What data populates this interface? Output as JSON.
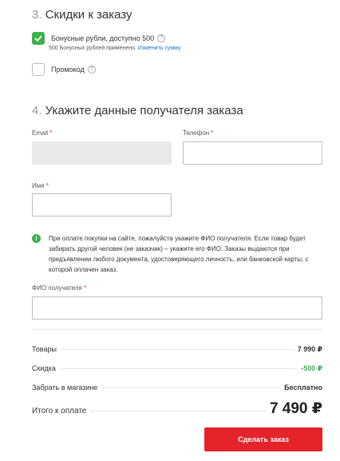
{
  "discounts": {
    "section_number": "3.",
    "section_title": "Скидки к заказу",
    "bonus_label": "Бонусные рубли, доступно 500",
    "bonus_checked": true,
    "bonus_applied_note": "500 Бонусных рублей применено.",
    "change_amount_link": "Изменить сумму",
    "promo_label": "Промокод",
    "promo_checked": false,
    "help_glyph": "?"
  },
  "recipient": {
    "section_number": "4.",
    "section_title": "Укажите данные получателя заказа",
    "email_label": "Email",
    "email_value": "",
    "phone_label": "Телефон",
    "phone_value": "",
    "name_label": "Имя",
    "name_value": "",
    "required_mark": "*",
    "info_text": "При оплате покупки на сайте, пожалуйста укажите ФИО получателя. Если товар будет забирать другой человек (не заказчик) – укажите его ФИО. Заказы выдаются при предъявлении любого документа, удостоверяющего личность, или банковской карты, с которой оплачен заказ.",
    "fio_label": "ФИО получателя",
    "fio_value": ""
  },
  "summary": {
    "goods_label": "Товары",
    "goods_value": "7 990 ₽",
    "discount_label": "Скидка",
    "discount_value": "-500 ₽",
    "pickup_label": "Забрать в магазине",
    "pickup_value": "Бесплатно",
    "total_label": "Итого к оплате",
    "total_value": "7 490 ₽"
  },
  "actions": {
    "place_order": "Сделать заказ"
  },
  "colors": {
    "accent_red": "#e4232a",
    "check_green": "#3bb24b",
    "link_blue": "#1a73c8"
  }
}
